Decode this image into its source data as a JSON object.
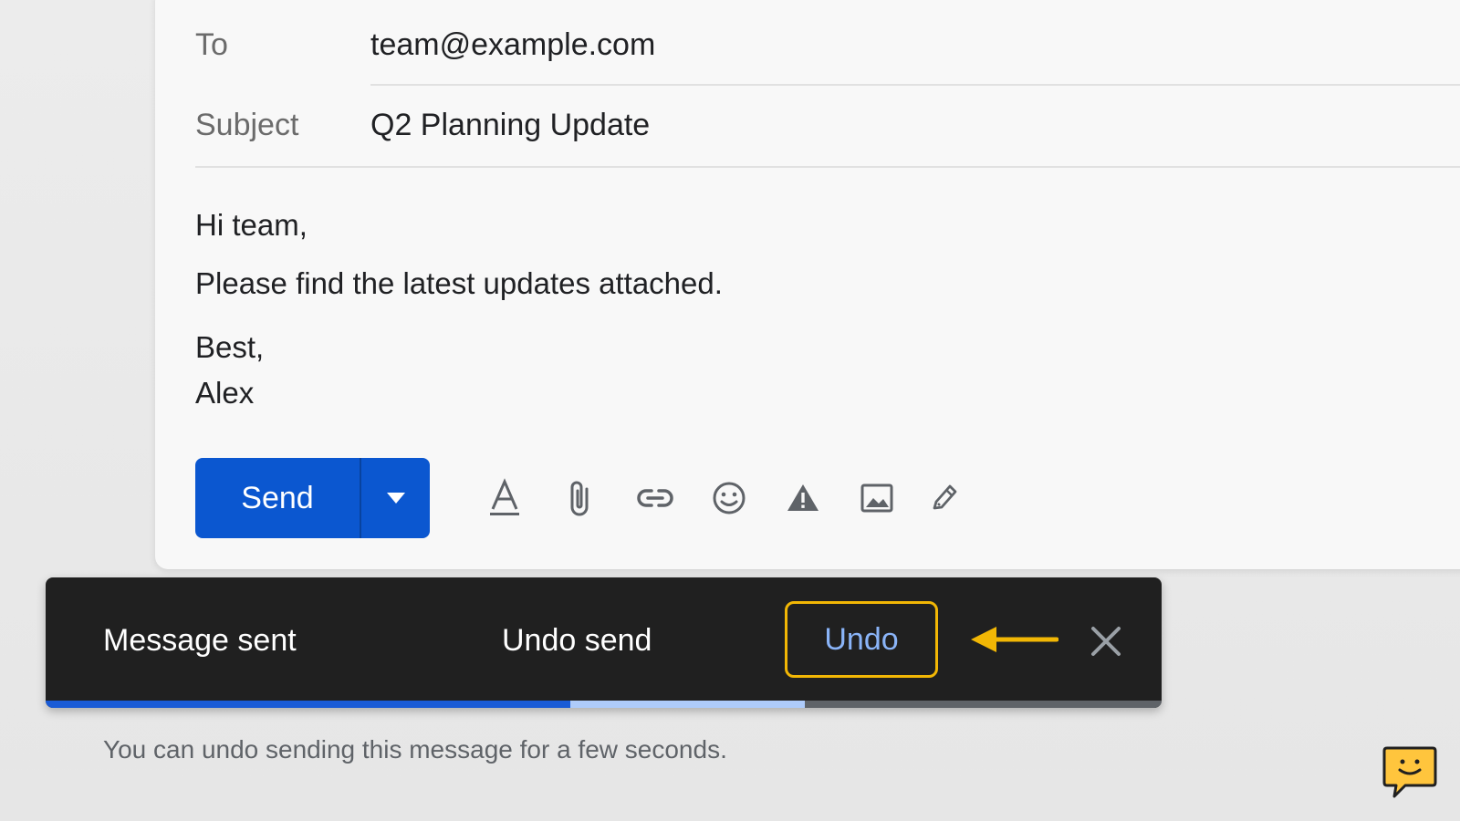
{
  "compose": {
    "to_label": "To",
    "to_value": "team@example.com",
    "subject_label": "Subject",
    "subject_value": "Q2 Planning Update",
    "body": {
      "greeting": "Hi team,",
      "line1": "Please find the latest updates attached.",
      "signoff": "Best,",
      "name": "Alex"
    }
  },
  "toolbar": {
    "send_label": "Send",
    "icons": [
      "send-options-icon",
      "text-format-icon",
      "attach-icon",
      "link-icon",
      "emoji-icon",
      "confidential-icon",
      "photo-icon",
      "signature-icon"
    ]
  },
  "snackbar": {
    "message": "Message sent",
    "secondary": "Undo send",
    "undo_label": "Undo",
    "progress_fraction": 0.47,
    "buffer_fraction": 0.21
  },
  "hint": "You can undo sending this message for a few seconds.",
  "colors": {
    "primary": "#0b57d0",
    "highlight": "#f2b705",
    "snackbar_bg": "#202020",
    "undo_text": "#8ab4f8"
  }
}
